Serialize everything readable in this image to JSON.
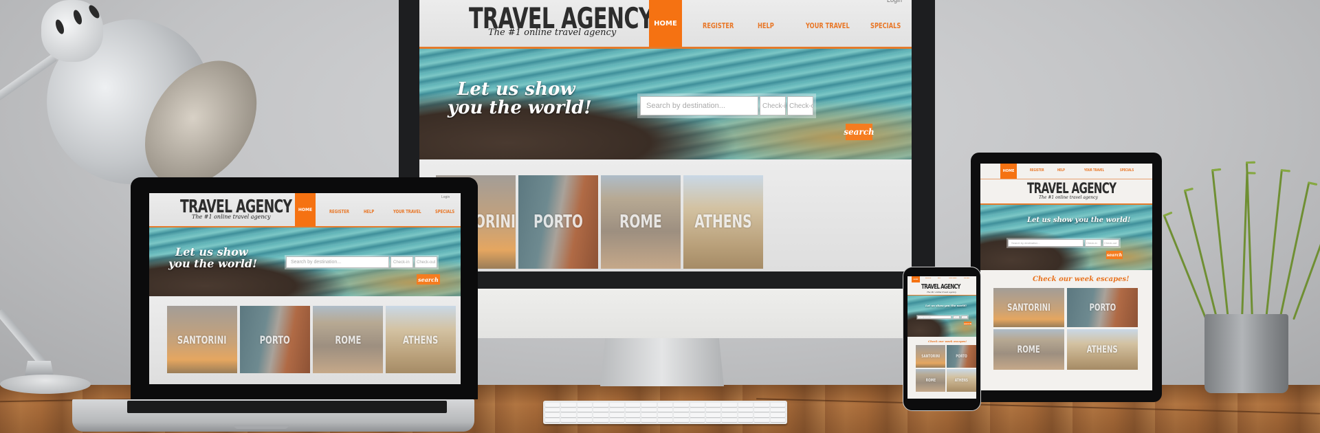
{
  "scene": {
    "description": "Responsive travel agency website shown on desktop, laptop, tablet and phone",
    "accent_color": "#f57212",
    "text_orange": "#e87626"
  },
  "site": {
    "brand": "TRAVEL AGENCY",
    "tagline": "The #1 online travel agency",
    "login_label": "Login",
    "nav": [
      {
        "label": "HOME",
        "active": true
      },
      {
        "label": "REGISTER",
        "active": false
      },
      {
        "label": "HELP",
        "active": false
      },
      {
        "label": "YOUR TRAVEL",
        "active": false
      },
      {
        "label": "SPECIALS",
        "active": false
      }
    ],
    "hero": {
      "headline_line1": "Let us show",
      "headline_line2": "you the world!",
      "headline_single": "Let us show you the world!"
    },
    "search": {
      "destination_placeholder": "Search by destination...",
      "checkin_placeholder": "Check-in",
      "checkout_placeholder": "Check-out",
      "button_label": "search"
    },
    "escapes_heading": "Check our week escapes!",
    "destinations": [
      "SANTORINI",
      "PORTO",
      "ROME",
      "ATHENS"
    ]
  }
}
